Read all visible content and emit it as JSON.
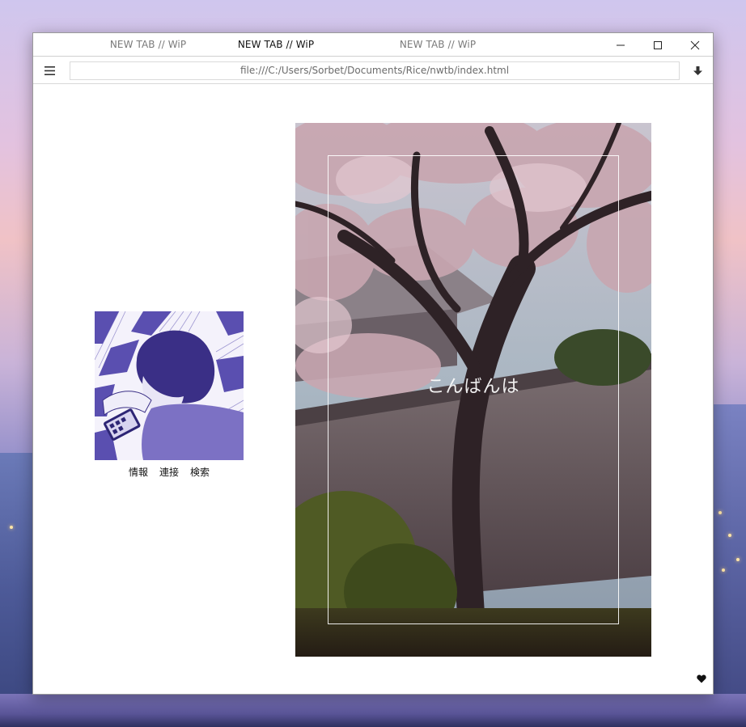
{
  "browser": {
    "tabs": [
      {
        "label": "NEW TAB // WiP",
        "active": false
      },
      {
        "label": "NEW TAB // WiP",
        "active": true
      },
      {
        "label": "NEW TAB // WiP",
        "active": false
      }
    ],
    "url": "file:///C:/Users/Sorbet/Documents/Rice/nwtb/index.html",
    "controls": [
      "minimize-icon",
      "maximize-icon",
      "close-icon"
    ],
    "menu_icon": "hamburger-menu-icon",
    "download_icon": "download-arrow-icon"
  },
  "page": {
    "links": [
      {
        "label": "情報"
      },
      {
        "label": "連接"
      },
      {
        "label": "検索"
      }
    ],
    "greeting": "こんばんは",
    "heart_icon": "heart-icon",
    "colors": {
      "avatar_tint": "#4b3f9e",
      "frame": "#ffffff",
      "page_bg": "#ffffff"
    }
  }
}
